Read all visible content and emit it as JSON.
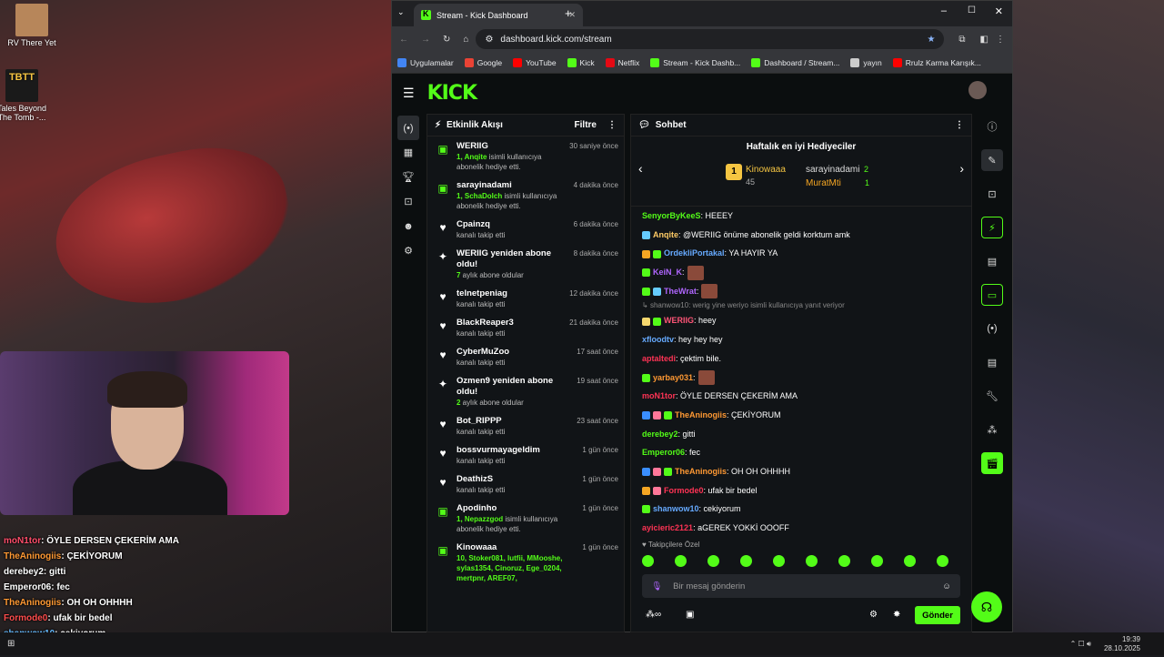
{
  "desktop": {
    "icon1": "RV There Yet",
    "icon2": "Tales Beyond The Tomb -..."
  },
  "stream_overlay_chat": [
    {
      "user": "moN1tor",
      "msg": ": ÖYLE DERSEN ÇEKERİM AMA",
      "color": "#ff4d6a"
    },
    {
      "user": "TheAninogiis",
      "msg": ": ÇEKİYORUM",
      "color": "#ff9933"
    },
    {
      "user": "derebey2",
      "msg": ": gitti",
      "color": "#ffffff"
    },
    {
      "user": "Emperor06",
      "msg": ": fec",
      "color": "#ffffff"
    },
    {
      "user": "TheAninogiis",
      "msg": ": OH OH OHHHH",
      "color": "#ff9933"
    },
    {
      "user": "Formode0",
      "msg": ": ufak bir bedel",
      "color": "#ff4d4d"
    },
    {
      "user": "shanwow10",
      "msg": ": cekiyorum",
      "color": "#66bbff"
    },
    {
      "user": "ayicieric2121",
      "msg": ": aGEREK YOKKİ OOOFF",
      "color": "#ff3355"
    }
  ],
  "browser": {
    "tab_title": "Stream - Kick Dashboard",
    "url": "dashboard.kick.com/stream",
    "bookmarks": [
      "Uygulamalar",
      "Google",
      "YouTube",
      "Kick",
      "Netflix",
      "Stream - Kick Dashb...",
      "Dashboard / Stream...",
      "yayın",
      "Rrulz Karma Karışık..."
    ]
  },
  "kick": {
    "logo": "KICK",
    "activity": {
      "title": "Etkinlik Akışı",
      "filter": "Filtre",
      "items": [
        {
          "icon": "▣",
          "name": "WERIIG",
          "sub_b": "1, Anqite",
          "sub": " isimli kullanıcıya abonelik hediye etti.",
          "time": "30 saniye önce"
        },
        {
          "icon": "▣",
          "name": "sarayinadami",
          "sub_b": "1, SchaDolch",
          "sub": " isimli kullanıcıya abonelik hediye etti.",
          "time": "4 dakika önce"
        },
        {
          "icon": "♥",
          "name": "Cpainzq",
          "sub_b": "",
          "sub": "kanalı takip etti",
          "time": "6 dakika önce"
        },
        {
          "icon": "✦",
          "name": "WERIIG yeniden abone oldu!",
          "sub_b": "7",
          "sub": " aylık abone oldular",
          "time": "8 dakika önce"
        },
        {
          "icon": "♥",
          "name": "telnetpeniag",
          "sub_b": "",
          "sub": "kanalı takip etti",
          "time": "12 dakika önce"
        },
        {
          "icon": "♥",
          "name": "BlackReaper3",
          "sub_b": "",
          "sub": "kanalı takip etti",
          "time": "21 dakika önce"
        },
        {
          "icon": "♥",
          "name": "CyberMuZoo",
          "sub_b": "",
          "sub": "kanalı takip etti",
          "time": "17 saat önce"
        },
        {
          "icon": "✦",
          "name": "Ozmen9 yeniden abone oldu!",
          "sub_b": "2",
          "sub": " aylık abone oldular",
          "time": "19 saat önce"
        },
        {
          "icon": "♥",
          "name": "Bot_RIPPP",
          "sub_b": "",
          "sub": "kanalı takip etti",
          "time": "23 saat önce"
        },
        {
          "icon": "♥",
          "name": "bossvurmayageldim",
          "sub_b": "",
          "sub": "kanalı takip etti",
          "time": "1 gün önce"
        },
        {
          "icon": "♥",
          "name": "DeathizS",
          "sub_b": "",
          "sub": "kanalı takip etti",
          "time": "1 gün önce"
        },
        {
          "icon": "▣",
          "name": "Apodinho",
          "sub_b": "1, Nepazzgod",
          "sub": " isimli kullanıcıya abonelik hediye etti.",
          "time": "1 gün önce"
        },
        {
          "icon": "▣",
          "name": "Kinowaaa",
          "sub_b": "10, Stoker081, lutfii, MMooshe, sylas1354, Cinoruz, Ege_0204, mertpnr, AREF07,",
          "sub": "",
          "time": "1 gün önce"
        }
      ]
    },
    "chat": {
      "title": "Sohbet",
      "gifters_title": "Haftalık en iyi Hediyeciler",
      "gifter1": {
        "rank": "1",
        "name": "Kinowaaa",
        "count": "45"
      },
      "gifter2": {
        "name": "sarayinadami",
        "count": "2"
      },
      "gifter3": {
        "name": "MuratMti",
        "count": "1"
      },
      "messages": [
        {
          "user": "SenyorByKeeS",
          "text": ": HEEEY",
          "color": "#53fc18",
          "badges": []
        },
        {
          "user": "Anqite",
          "text": ": @WERIIG önüme abonelik geldi korktum amk",
          "color": "#ffcc66",
          "badges": [
            "#66ccff"
          ]
        },
        {
          "user": "OrdekliPortakal",
          "text": ": YA HAYIR YA",
          "color": "#66aaff",
          "badges": [
            "#f5a623",
            "#53fc18"
          ]
        },
        {
          "user": "KeiN_K",
          "text": ":",
          "color": "#b066ff",
          "badges": [
            "#53fc18"
          ],
          "emote": true
        },
        {
          "user": "TheWrat",
          "text": ":",
          "color": "#b066ff",
          "badges": [
            "#53fc18",
            "#66ccff"
          ],
          "emote": true
        },
        {
          "user": "WERIIG",
          "text": ": heey",
          "color": "#ff5577",
          "badges": [
            "#f5d76e",
            "#53fc18"
          ]
        },
        {
          "user": "xfloodtv",
          "text": ": hey hey hey",
          "color": "#66aaff",
          "badges": []
        },
        {
          "user": "aptaltedi",
          "text": ": çektim bile.",
          "color": "#ff3355",
          "badges": []
        },
        {
          "user": "yarbay031",
          "text": ":",
          "color": "#ff9933",
          "badges": [
            "#53fc18"
          ],
          "emote": true
        },
        {
          "user": "moN1tor",
          "text": ": ÖYLE DERSEN ÇEKERİM AMA",
          "color": "#ff3355",
          "badges": []
        },
        {
          "user": "TheAninogiis",
          "text": ": ÇEKİYORUM",
          "color": "#ff9933",
          "badges": [
            "#3a8eff",
            "#ff7799",
            "#53fc18"
          ]
        },
        {
          "user": "derebey2",
          "text": ": gitti",
          "color": "#53fc18",
          "badges": []
        },
        {
          "user": "Emperor06",
          "text": ": fec",
          "color": "#53fc18",
          "badges": []
        },
        {
          "user": "TheAninogiis",
          "text": ": OH OH OHHHH",
          "color": "#ff9933",
          "badges": [
            "#3a8eff",
            "#ff7799",
            "#53fc18"
          ]
        },
        {
          "user": "Formode0",
          "text": ": ufak bir bedel",
          "color": "#ff3355",
          "badges": [
            "#f5a623",
            "#ff7799"
          ]
        },
        {
          "user": "shanwow10",
          "text": ": cekiyorum",
          "color": "#66aaff",
          "badges": [
            "#53fc18"
          ]
        },
        {
          "user": "ayicieric2121",
          "text": ": aGEREK YOKKİ OOOFF",
          "color": "#ff3355",
          "badges": []
        }
      ],
      "reply_hint": "shanwow10: werig yine weriyo isimli kullanıcıya yanıt veriyor",
      "followers_only": "Takipçilere Özel",
      "input_placeholder": "Bir mesaj gönderin",
      "send": "Gönder"
    }
  },
  "taskbar": {
    "time": "19:39",
    "date": "28.10.2025"
  }
}
